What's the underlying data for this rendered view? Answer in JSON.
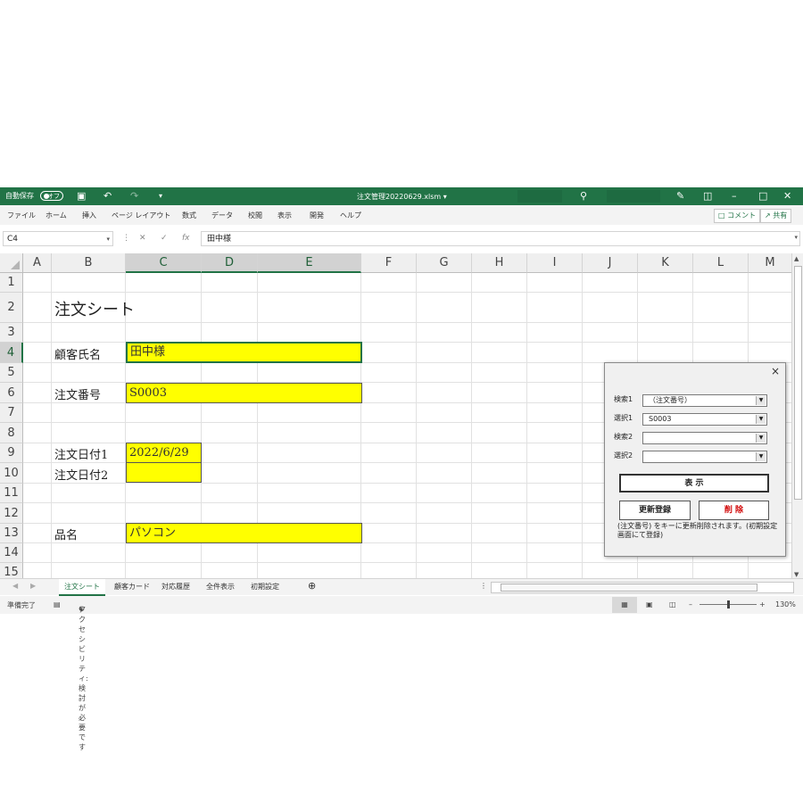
{
  "titlebar": {
    "autosave_label": "自動保存",
    "autosave_state": "オフ",
    "doc_title": "注文管理20220629.xlsm",
    "icons": [
      "save-icon",
      "undo-icon",
      "redo-icon",
      "customize-icon",
      "search-icon",
      "pen-icon",
      "ribbon-display-icon",
      "minimize-icon",
      "restore-icon",
      "close-icon"
    ]
  },
  "ribbon": {
    "tabs": [
      "ファイル",
      "ホーム",
      "挿入",
      "ページ レイアウト",
      "数式",
      "データ",
      "校閲",
      "表示",
      "開発",
      "ヘルプ"
    ],
    "comment_label": "コメント",
    "share_label": "共有"
  },
  "formula_bar": {
    "name_box": "C4",
    "value": "田中様"
  },
  "columns": [
    "A",
    "B",
    "C",
    "D",
    "E",
    "F",
    "G",
    "H",
    "I",
    "J",
    "K",
    "L",
    "M"
  ],
  "rows": [
    "1",
    "2",
    "3",
    "4",
    "5",
    "6",
    "7",
    "8",
    "9",
    "10",
    "11",
    "12",
    "13",
    "14",
    "15"
  ],
  "selection": {
    "cell": "C4",
    "columns": [
      "C",
      "D",
      "E"
    ],
    "row": "4"
  },
  "sheet": {
    "title": "注文シート",
    "customer_label": "顧客氏名",
    "customer_value": "田中様",
    "order_no_label": "注文番号",
    "order_no_value": "S0003",
    "order_date1_label": "注文日付1",
    "order_date1_value": "2022/6/29",
    "order_date2_label": "注文日付2",
    "order_date2_value": "",
    "product_label": "品名",
    "product_value": "パソコン",
    "input_fill_color": "#ffff00"
  },
  "sheet_tabs": [
    "注文シート",
    "顧客カード",
    "対応履歴",
    "全件表示",
    "初期設定"
  ],
  "active_sheet_tab": "注文シート",
  "status": {
    "ready": "準備完了",
    "accessibility": "アクセシビリティ: 検討が必要です",
    "zoom": "130%"
  },
  "dialog": {
    "close_label": "×",
    "search1_label": "検索1",
    "search1_value": "（注文番号）",
    "select1_label": "選択1",
    "select1_value": "S0003",
    "search2_label": "検索2",
    "search2_value": "",
    "select2_label": "選択2",
    "select2_value": "",
    "show_button": "表 示",
    "update_button": "更新登録",
    "delete_button": "削 除",
    "note": "(注文番号) をキーに更新削除されます。(初期設定画面にて登録)"
  },
  "colors": {
    "excel_green": "#217346",
    "delete_text": "#d00000"
  }
}
